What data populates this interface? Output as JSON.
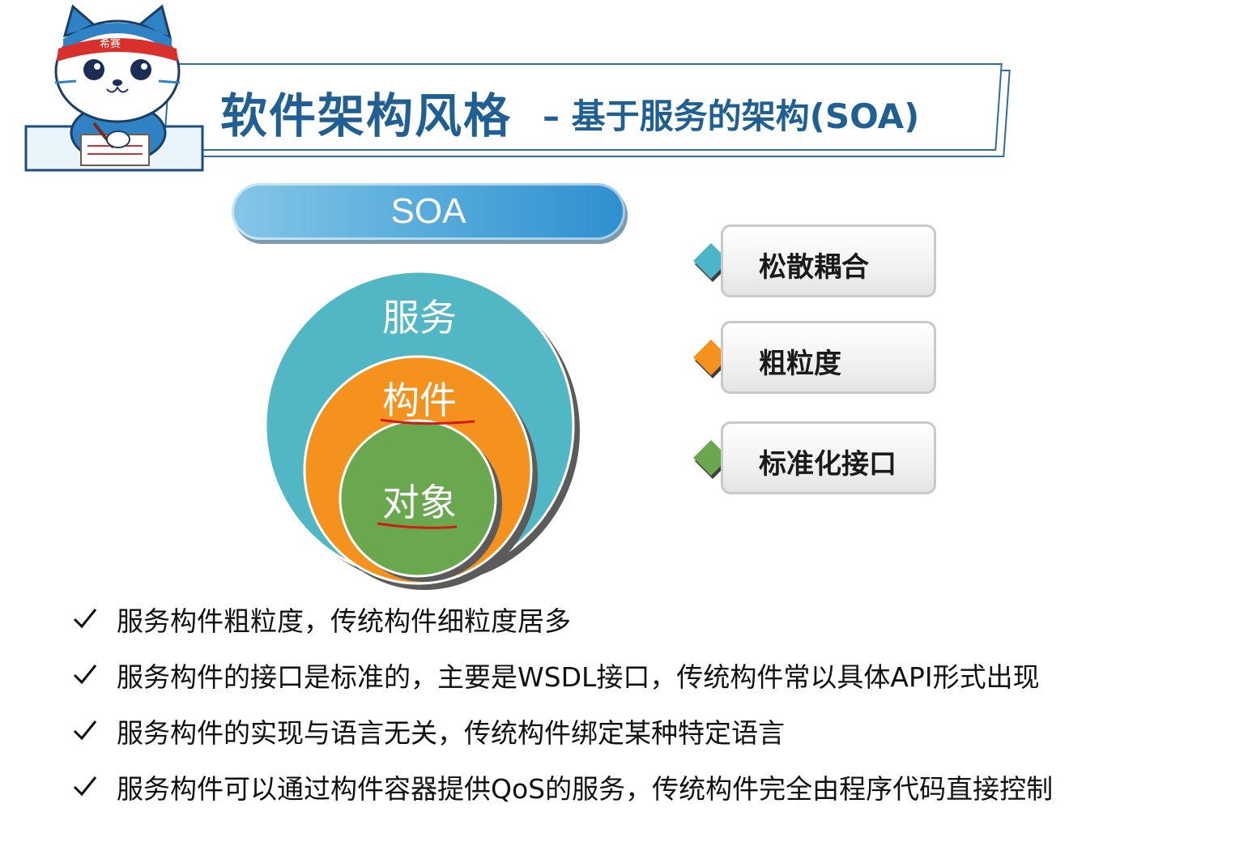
{
  "header": {
    "title": "软件架构风格",
    "subtitle": "– 基于服务的架构(SOA)",
    "mascot_badge": "希赛"
  },
  "soa_label": "SOA",
  "circles": {
    "outer": "服务",
    "middle": "构件",
    "inner": "对象",
    "colors": {
      "outer": "#52b7c5",
      "middle": "#f5921e",
      "inner": "#6aa84f"
    }
  },
  "features": [
    {
      "label": "松散耦合",
      "color": "#4bb6c8"
    },
    {
      "label": "粗粒度",
      "color": "#f5921e"
    },
    {
      "label": "标准化接口",
      "color": "#6aa84f"
    }
  ],
  "bullets": [
    "服务构件粗粒度，传统构件细粒度居多",
    "服务构件的接口是标准的，主要是WSDL接口，传统构件常以具体API形式出现",
    "服务构件的实现与语言无关，传统构件绑定某种特定语言",
    "服务构件可以通过构件容器提供QoS的服务，传统构件完全由程序代码直接控制"
  ]
}
